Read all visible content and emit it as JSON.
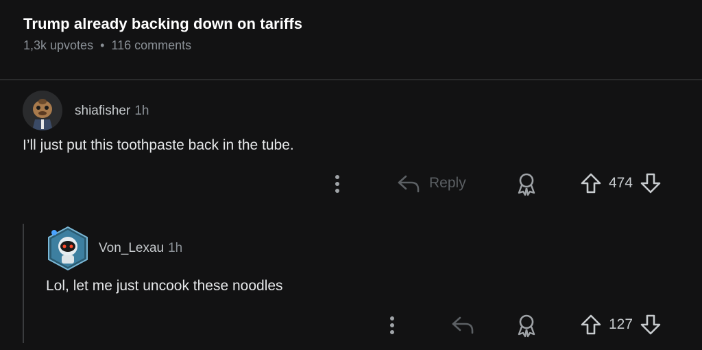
{
  "post": {
    "title": "Trump already backing down on tariffs",
    "upvotes": "1,3k upvotes",
    "separator": "•",
    "comments": "116 comments"
  },
  "comments": [
    {
      "author": "shiafisher",
      "time": "1h",
      "body": "I’ll just put this toothpaste back in the tube.",
      "reply_label": "Reply",
      "votes": "474"
    },
    {
      "author": "Von_Lexau",
      "time": "1h",
      "body": "Lol, let me just uncook these noodles",
      "votes": "127"
    }
  ],
  "colors": {
    "background": "#121213",
    "text": "#d7dadc",
    "muted": "#8a9096"
  }
}
